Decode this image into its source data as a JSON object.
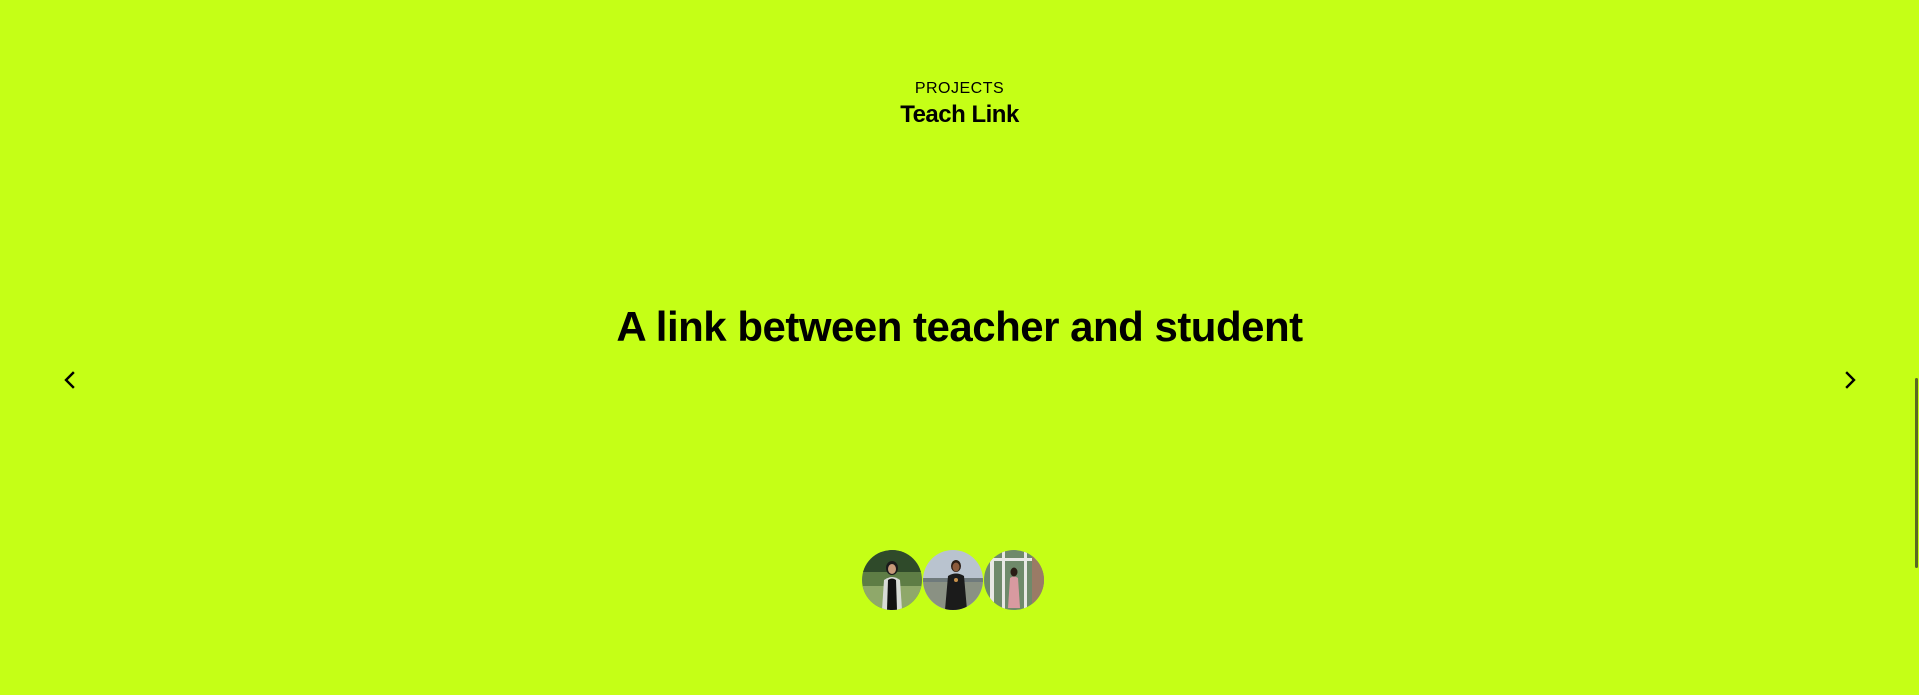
{
  "section": {
    "eyebrow": "PROJECTS",
    "title": "Teach Link"
  },
  "slide": {
    "headline": "A link between teacher and student"
  },
  "carousel": {
    "prev_icon": "chevron-left-icon",
    "next_icon": "chevron-right-icon"
  },
  "team": {
    "avatars": [
      "avatar-1",
      "avatar-2",
      "avatar-3"
    ]
  },
  "colors": {
    "background": "#c5ff16",
    "text": "#000000"
  }
}
